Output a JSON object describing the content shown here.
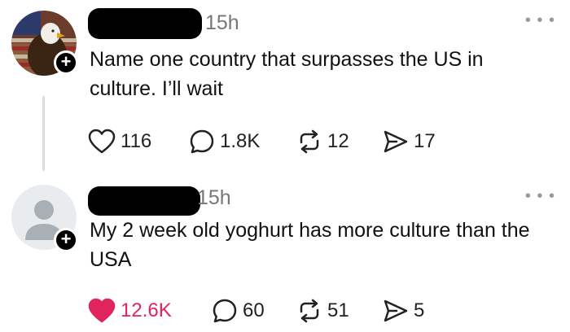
{
  "posts": [
    {
      "time": "15h",
      "text": "Name one country that surpasses the US in culture. I’ll wait",
      "likes": "116",
      "comments": "1.8K",
      "reposts": "12",
      "shares": "17",
      "liked": false
    },
    {
      "time": "15h",
      "text": "My 2 week old yoghurt has more culture than the USA",
      "likes": "12.6K",
      "comments": "60",
      "reposts": "51",
      "shares": "5",
      "liked": true
    }
  ],
  "colors": {
    "like_active": "#e0245e",
    "muted_text": "#777777",
    "icon_stroke": "#222222"
  },
  "icons": [
    "heart-icon",
    "comment-icon",
    "repost-icon",
    "share-icon",
    "more-icon",
    "follow-plus-icon"
  ]
}
